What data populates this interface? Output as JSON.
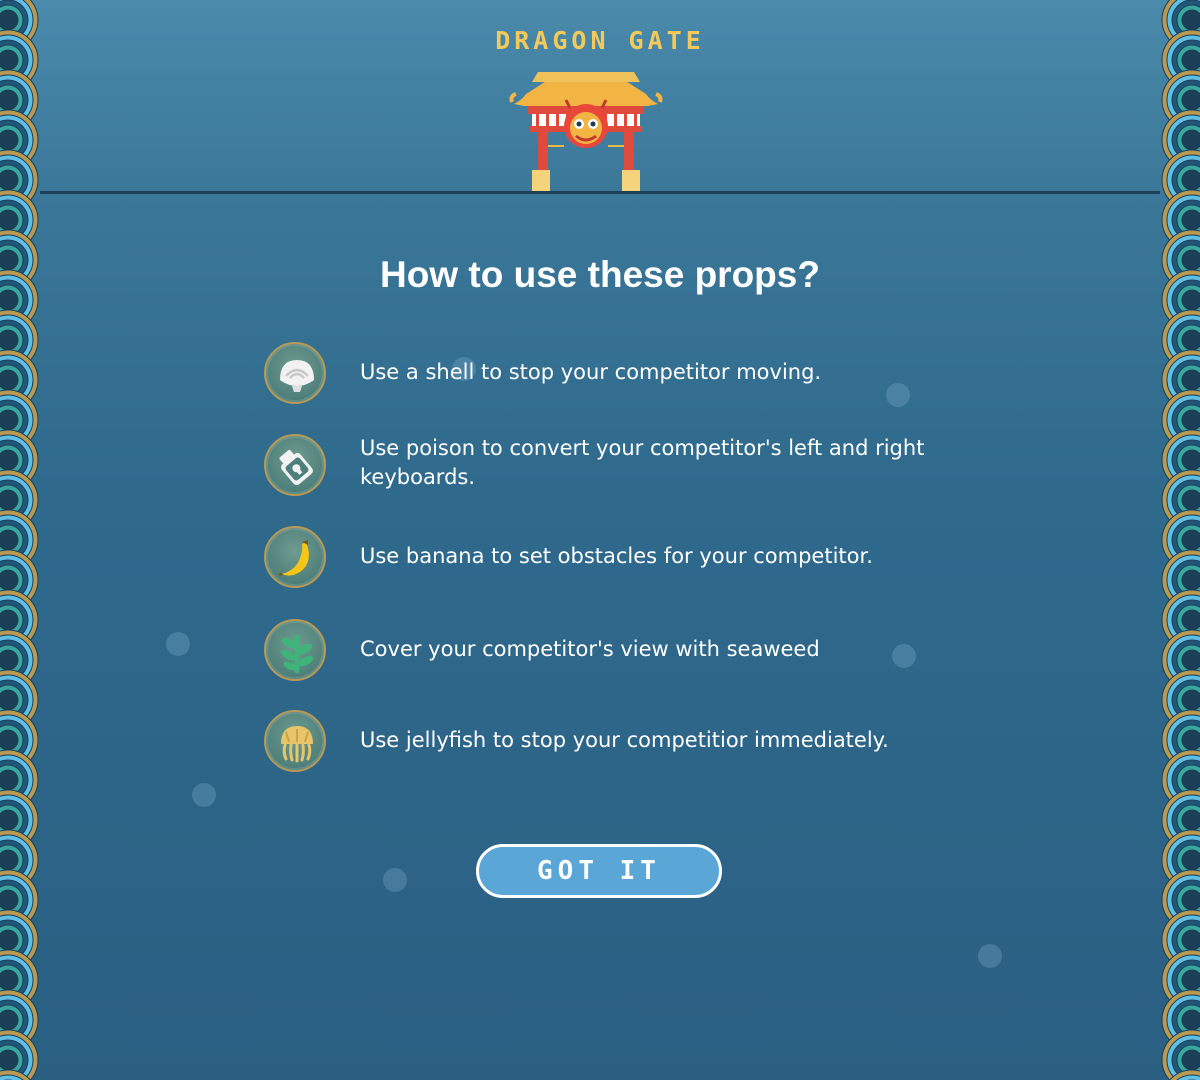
{
  "game": {
    "title": "DRAGON GATE"
  },
  "dialog": {
    "heading": "How to use these props?",
    "props": [
      {
        "icon": "shell-icon",
        "text": "Use a shell to stop your competitor moving."
      },
      {
        "icon": "poison-icon",
        "text": "Use poison to convert your competitor's left and right keyboards."
      },
      {
        "icon": "banana-icon",
        "text": "Use banana to set obstacles for your competitor."
      },
      {
        "icon": "seaweed-icon",
        "text": "Cover your competitor's view with seaweed"
      },
      {
        "icon": "jellyfish-icon",
        "text": "Use jellyfish to stop your competitior immediately."
      }
    ],
    "confirm_label": "GOT IT"
  },
  "colors": {
    "background": "#2f6a8d",
    "title": "#f3c95a",
    "button": "#5aa6d6",
    "scale_border": "#b99a55"
  }
}
